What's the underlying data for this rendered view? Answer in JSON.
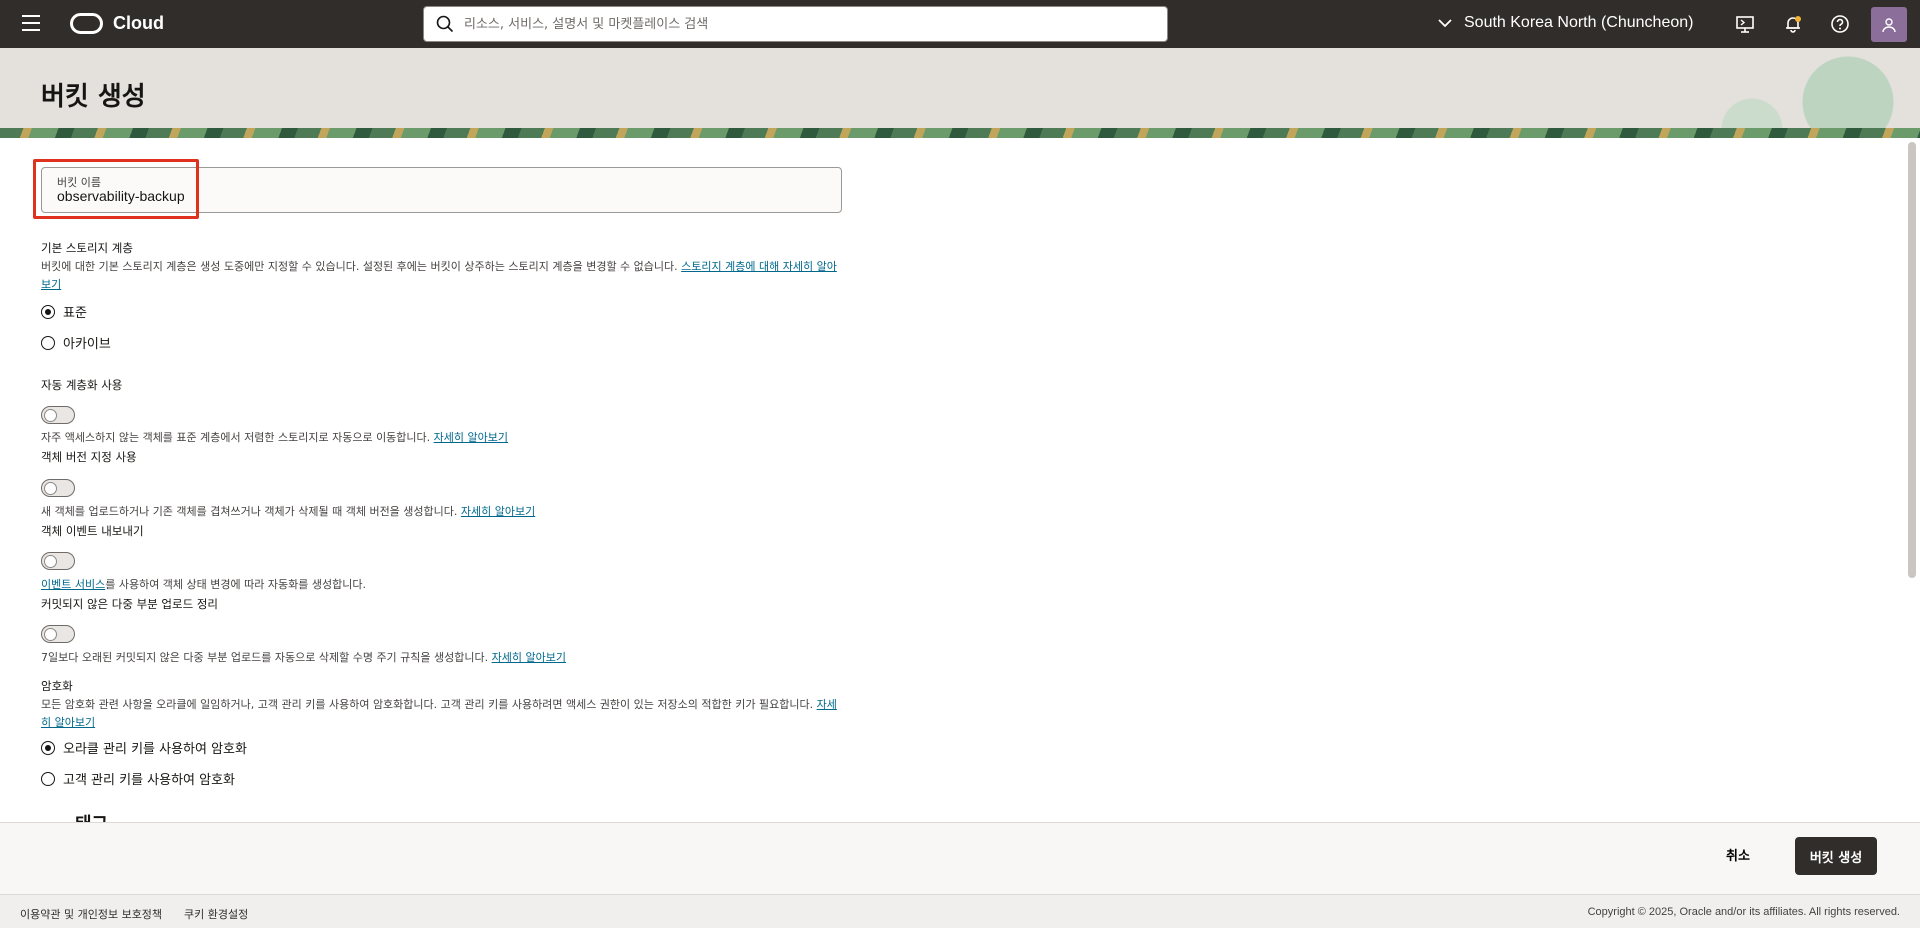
{
  "topbar": {
    "brand": "Cloud",
    "search_placeholder": "리소스, 서비스, 설명서 및 마켓플레이스 검색",
    "region": "South Korea North (Chuncheon)"
  },
  "page": {
    "title": "버킷 생성"
  },
  "form": {
    "bucket_name_label": "버킷 이름",
    "bucket_name_value": "observability-backup",
    "storage_tier": {
      "title": "기본 스토리지 계층",
      "description": "버킷에 대한 기본 스토리지 계층은 생성 도중에만 지정할 수 있습니다. 설정된 후에는 버킷이 상주하는 스토리지 계층을 변경할 수 없습니다. ",
      "link": "스토리지 계층에 대해 자세히 알아보기",
      "options": [
        "표준",
        "아카이브"
      ],
      "selected": "표준"
    },
    "auto_tiering": {
      "title": "자동 계층화 사용",
      "enabled": false,
      "description": "자주 액세스하지 않는 객체를 표준 계층에서 저렴한 스토리지로 자동으로 이동합니다. ",
      "link": "자세히 알아보기"
    },
    "versioning": {
      "title": "객체 버전 지정 사용",
      "enabled": false,
      "description": "새 객체를 업로드하거나 기존 객체를 겹쳐쓰거나 객체가 삭제될 때 객체 버전을 생성합니다. ",
      "link": "자세히 알아보기"
    },
    "events": {
      "title": "객체 이벤트 내보내기",
      "enabled": false,
      "link": "이벤트 서비스",
      "description": "를 사용하여 객체 상태 변경에 따라 자동화를 생성합니다."
    },
    "cleanup": {
      "title": "커밋되지 않은 다중 부분 업로드 정리",
      "enabled": false,
      "description": "7일보다 오래된 커밋되지 않은 다중 부분 업로드를 자동으로 삭제할 수명 주기 규칙을 생성합니다. ",
      "link": "자세히 알아보기"
    },
    "encryption": {
      "title": "암호화",
      "description": "모든 암호화 관련 사항을 오라클에 일임하거나, 고객 관리 키를 사용하여 암호화합니다. 고객 관리 키를 사용하려면 액세스 권한이 있는 저장소의 적합한 키가 필요합니다. ",
      "link": "자세히 알아보기",
      "options": [
        "오라클 관리 키를 사용하여 암호화",
        "고객 관리 키를 사용하여 암호화"
      ],
      "selected": "오라클 관리 키를 사용하여 암호화"
    },
    "next_section_partial": "태그"
  },
  "actions": {
    "cancel": "취소",
    "create": "버킷 생성"
  },
  "footer": {
    "terms": "이용약관 및 개인정보 보호정책",
    "cookies": "쿠키 환경설정",
    "copyright": "Copyright © 2025, Oracle and/or its affiliates. All rights reserved."
  }
}
